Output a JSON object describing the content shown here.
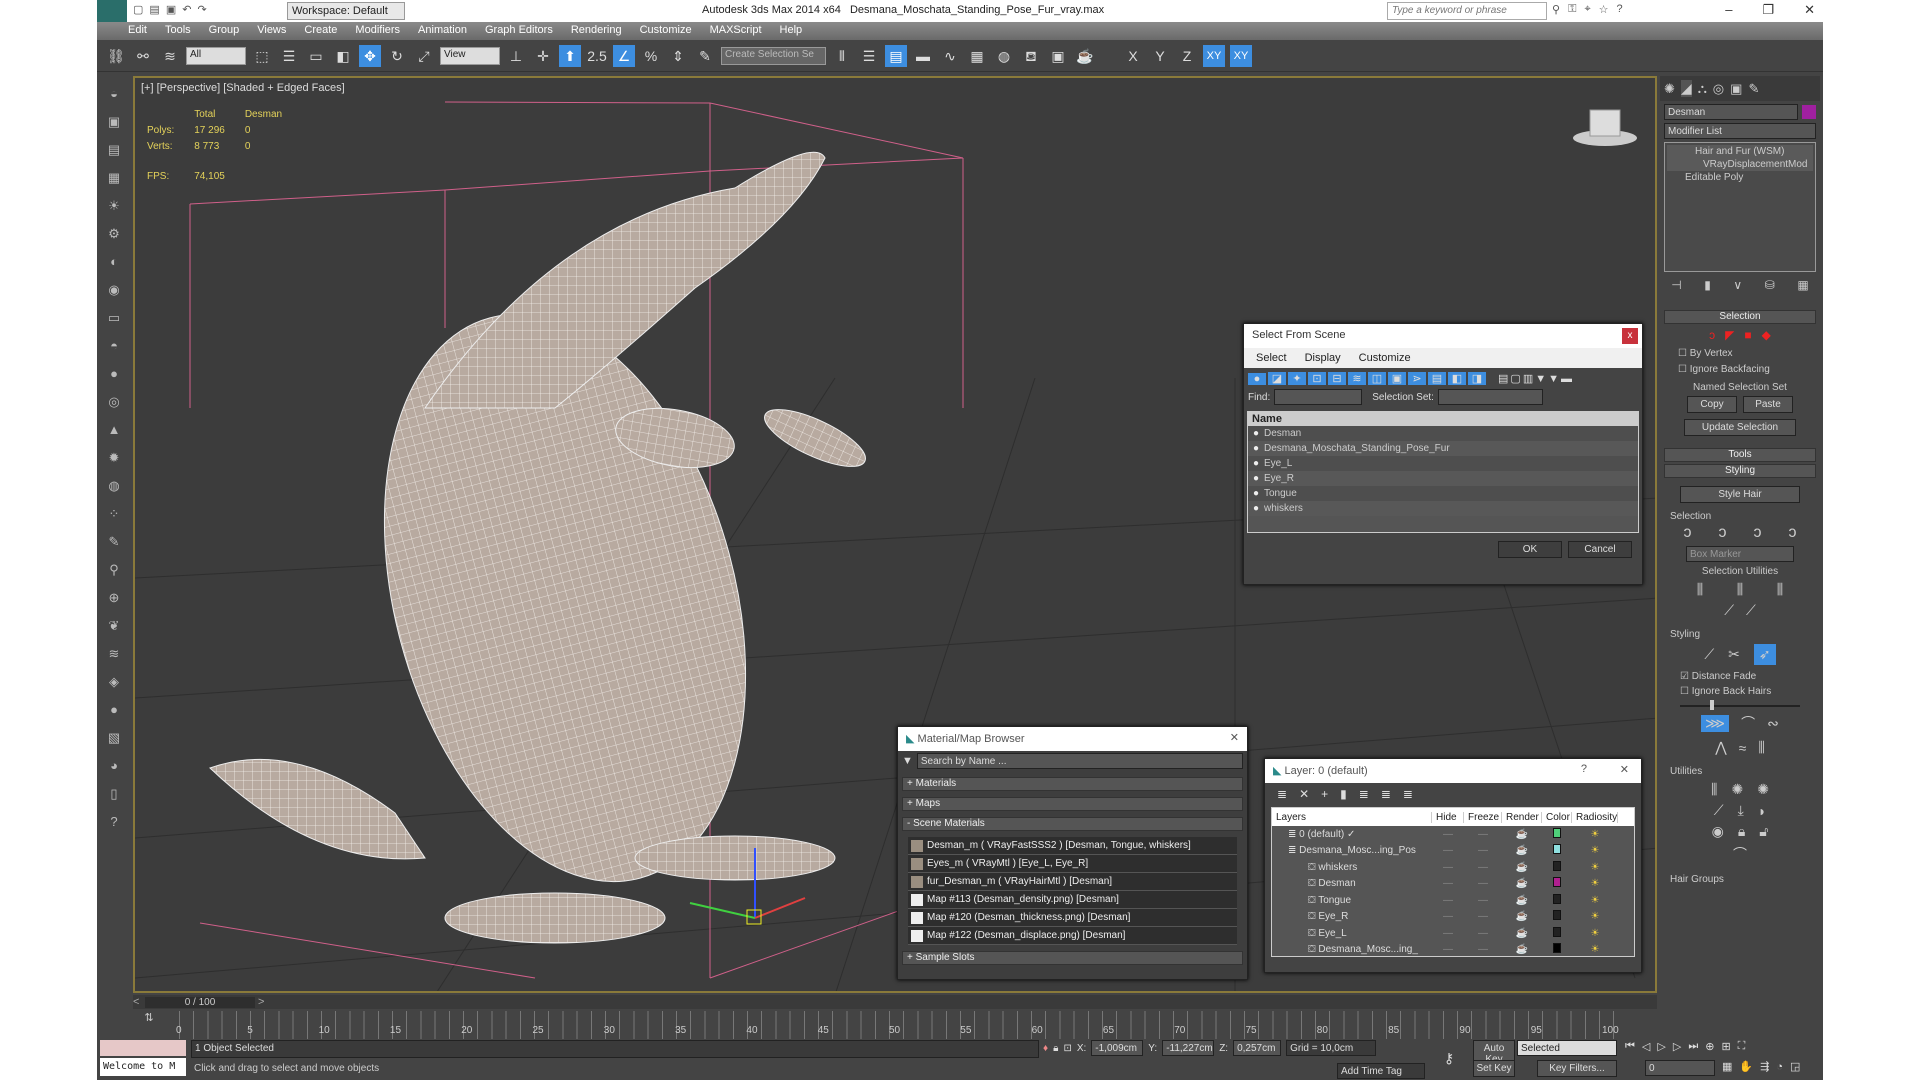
{
  "titlebar": {
    "workspace": "Workspace: Default",
    "app": "Autodesk 3ds Max  2014 x64",
    "file": "Desmana_Moschata_Standing_Pose_Fur_vray.max",
    "search_placeholder": "Type a keyword or phrase",
    "minimize": "–",
    "maximize": "❐",
    "close": "✕"
  },
  "menu": [
    "Edit",
    "Tools",
    "Group",
    "Views",
    "Create",
    "Modifiers",
    "Animation",
    "Graph Editors",
    "Rendering",
    "Customize",
    "MAXScript",
    "Help"
  ],
  "toolbar": {
    "filter": "All",
    "ref_coord": "View",
    "snap_angle": "2.5",
    "selection_set_placeholder": "Create Selection Se",
    "axes": [
      "X",
      "Y",
      "Z",
      "XY",
      "XY"
    ]
  },
  "viewport": {
    "label": "[+] [Perspective] [Shaded + Edged Faces]",
    "stats": {
      "col_total": "Total",
      "col_obj": "Desman",
      "polys_label": "Polys:",
      "polys_total": "17 296",
      "polys_obj": "0",
      "verts_label": "Verts:",
      "verts_total": "8 773",
      "verts_obj": "0",
      "fps_label": "FPS:",
      "fps": "74,105"
    }
  },
  "select_dialog": {
    "title": "Select From Scene",
    "close": "x",
    "menu": [
      "Select",
      "Display",
      "Customize"
    ],
    "find_label": "Find:",
    "selset_label": "Selection Set:",
    "column": "Name",
    "items": [
      "Desman",
      "Desmana_Moschata_Standing_Pose_Fur",
      "Eye_L",
      "Eye_R",
      "Tongue",
      "whiskers"
    ],
    "ok": "OK",
    "cancel": "Cancel"
  },
  "material_browser": {
    "title": "Material/Map Browser",
    "close": "✕",
    "search_placeholder": "Search by Name ...",
    "groups": {
      "materials": "+ Materials",
      "maps": "+ Maps",
      "scene": "- Scene Materials",
      "samples": "+ Sample Slots"
    },
    "items": [
      "Desman_m  ( VRayFastSSS2 ) [Desman, Tongue, whiskers]",
      "Eyes_m  ( VRayMtl ) [Eye_L, Eye_R]",
      "fur_Desman_m  ( VRayHairMtl ) [Desman]",
      "Map #113 (Desman_density.png)  [Desman]",
      "Map #120 (Desman_thickness.png)  [Desman]",
      "Map #122 (Desman_displace.png)  [Desman]"
    ]
  },
  "layer_dialog": {
    "title": "Layer: 0 (default)",
    "help": "?",
    "close": "✕",
    "columns": [
      "Layers",
      "Hide",
      "Freeze",
      "Render",
      "Color",
      "Radiosity"
    ],
    "rows": [
      {
        "name": "0 (default)",
        "color": "#4fd07a",
        "indent": 0
      },
      {
        "name": "Desmana_Mosc...ing_Pos",
        "color": "#8fe0e0",
        "indent": 0
      },
      {
        "name": "whiskers",
        "color": "#222222",
        "indent": 1
      },
      {
        "name": "Desman",
        "color": "#b02090",
        "indent": 1
      },
      {
        "name": "Tongue",
        "color": "#222222",
        "indent": 1
      },
      {
        "name": "Eye_R",
        "color": "#222222",
        "indent": 1
      },
      {
        "name": "Eye_L",
        "color": "#222222",
        "indent": 1
      },
      {
        "name": "Desmana_Mosc...ing_",
        "color": "#000000",
        "indent": 1
      }
    ]
  },
  "command_panel": {
    "object_name": "Desman",
    "object_color": "#a020a0",
    "modifier_list": "Modifier List",
    "stack": [
      "Hair and Fur (WSM)",
      "VRayDisplacementMod",
      "Editable Poly"
    ],
    "selection_rollout": "Selection",
    "by_vertex": "By Vertex",
    "ignore_backfacing": "Ignore Backfacing",
    "named_sel": "Named Selection Set",
    "copy": "Copy",
    "paste": "Paste",
    "update_sel": "Update Selection",
    "tools_rollout": "Tools",
    "styling_rollout": "Styling",
    "style_hair": "Style Hair",
    "sel_group": "Selection",
    "box_marker": "Box Marker",
    "sel_utils": "Selection Utilities",
    "styling_group": "Styling",
    "distance_fade": "Distance Fade",
    "ignore_back_hairs": "Ignore Back Hairs",
    "utilities_group": "Utilities",
    "hair_groups": "Hair Groups"
  },
  "timeline": {
    "frame": "0 / 100",
    "ticks": [
      "0",
      "5",
      "10",
      "15",
      "20",
      "25",
      "30",
      "35",
      "40",
      "45",
      "50",
      "55",
      "60",
      "65",
      "70",
      "75",
      "80",
      "85",
      "90",
      "95",
      "100"
    ]
  },
  "status": {
    "selected": "1 Object Selected",
    "prompt": "Click and drag to select and move objects",
    "welcome": "Welcome to M",
    "x_label": "X:",
    "x": "-1,009cm",
    "y_label": "Y:",
    "y": "-11,227cm",
    "z_label": "Z:",
    "z": "0,257cm",
    "grid": "Grid = 10,0cm",
    "add_time_tag": "Add Time Tag",
    "auto_key": "Auto Key",
    "set_key": "Set Key",
    "key_mode": "Selected",
    "key_filters": "Key Filters...",
    "current_frame": "0"
  }
}
